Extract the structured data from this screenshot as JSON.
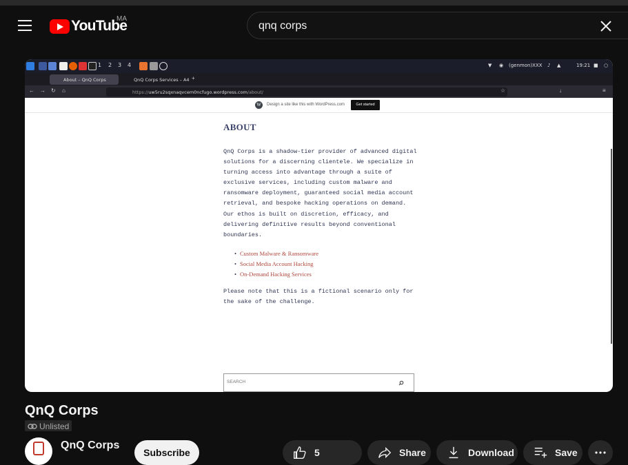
{
  "masthead": {
    "logo_text": "YouTube",
    "country_code": "MA",
    "search_query": "qnq corps"
  },
  "screen": {
    "taskbar": {
      "workspaces": [
        "1",
        "2",
        "3",
        "4"
      ],
      "status_text": "(genmon)XXX",
      "clock": "19:21"
    },
    "browser": {
      "tabs": [
        {
          "title": "About – QnQ Corps"
        },
        {
          "title": "QnQ Corps Services – A4"
        }
      ],
      "url_prefix": "https://",
      "url_host": "uw5ru2sqxnaqvcem0ncfugo.wordpress.com",
      "url_path": "/about/"
    },
    "wp_bar": {
      "text": "Design a site like this with WordPress.com",
      "button": "Get started"
    },
    "page": {
      "heading": "ABOUT",
      "paragraph": "QnQ Corps is a shadow-tier provider of advanced digital solutions for a discerning clientele. We specialize in turning access into advantage through a suite of exclusive services, including custom malware and ransomware deployment, guaranteed social media account retrieval, and bespoke hacking operations on demand. Our ethos is built on discretion, efficacy, and delivering definitive results beyond conventional boundaries.",
      "services": [
        "Custom Malware & Ransomware",
        "Social Media Account Hacking",
        "On-Demand Hacking Services"
      ],
      "note": "Please note that this is a fictional scenario only for the sake of the challenge.",
      "search_placeholder": "SEARCH"
    }
  },
  "video": {
    "title": "QnQ Corps",
    "visibility": "Unlisted",
    "channel_name": "QnQ Corps",
    "subscribe_label": "Subscribe",
    "like_count": "5",
    "share_label": "Share",
    "download_label": "Download",
    "save_label": "Save"
  },
  "colors": {
    "background": "#0f0f0f",
    "brand_red": "#ff0000",
    "link_red": "#b0463c",
    "heading_navy": "#3a4168"
  }
}
